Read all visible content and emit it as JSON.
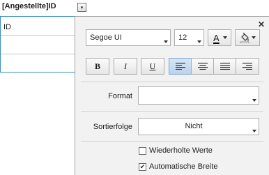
{
  "field": {
    "title": "[Angestellte]ID",
    "dropdown_glyph": "▾",
    "rows": [
      "ID",
      "",
      ""
    ]
  },
  "panel": {
    "close_glyph": "✕",
    "font_name": "Segoe UI",
    "font_size": "12",
    "font_color_letter": "A",
    "font_color_value": "#000000",
    "fill_color_value": "#ffffff",
    "bold_label": "B",
    "italic_label": "I",
    "underline_label": "U",
    "alignment_active": "align-left",
    "format_label": "Format",
    "format_value": "",
    "sort_label": "Sortierfolge",
    "sort_value": "Nicht",
    "repeated_values_label": "Wiederholte Werte",
    "repeated_values_checked": false,
    "auto_width_label": "Automatische Breite",
    "auto_width_checked": true
  }
}
